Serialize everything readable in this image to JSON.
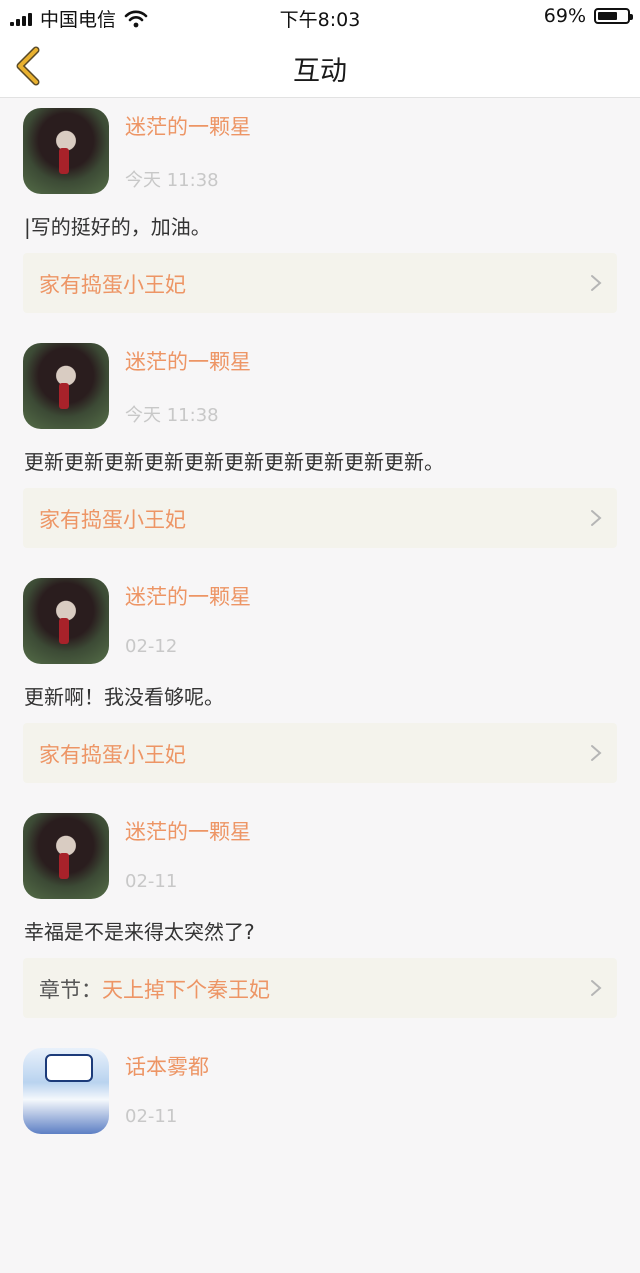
{
  "status": {
    "carrier": "中国电信",
    "time": "下午8:03",
    "battery": "69%",
    "battery_level": 0.69
  },
  "header": {
    "title": "互动",
    "back_icon": "chevron-left-icon"
  },
  "feed": [
    {
      "user": "迷茫的一颗星",
      "time": "今天 11:38",
      "comment": "|写的挺好的，加油。",
      "source_prefix": "",
      "source": "家有捣蛋小王妃"
    },
    {
      "user": "迷茫的一颗星",
      "time": "今天 11:38",
      "comment": "更新更新更新更新更新更新更新更新更新更新。",
      "source_prefix": "",
      "source": "家有捣蛋小王妃"
    },
    {
      "user": "迷茫的一颗星",
      "time": "02-12",
      "comment": "更新啊！我没看够呢。",
      "source_prefix": "",
      "source": "家有捣蛋小王妃"
    },
    {
      "user": "迷茫的一颗星",
      "time": "02-11",
      "comment": "幸福是不是来得太突然了?",
      "source_prefix": "章节：",
      "source": "天上掉下个秦王妃"
    },
    {
      "user": "话本雾都",
      "time": "02-11",
      "comment": "",
      "source_prefix": "",
      "source": ""
    }
  ],
  "colors": {
    "accent": "#ed9565",
    "card_bg": "#f4f3ec",
    "back_arrow": "#e9b12f"
  }
}
